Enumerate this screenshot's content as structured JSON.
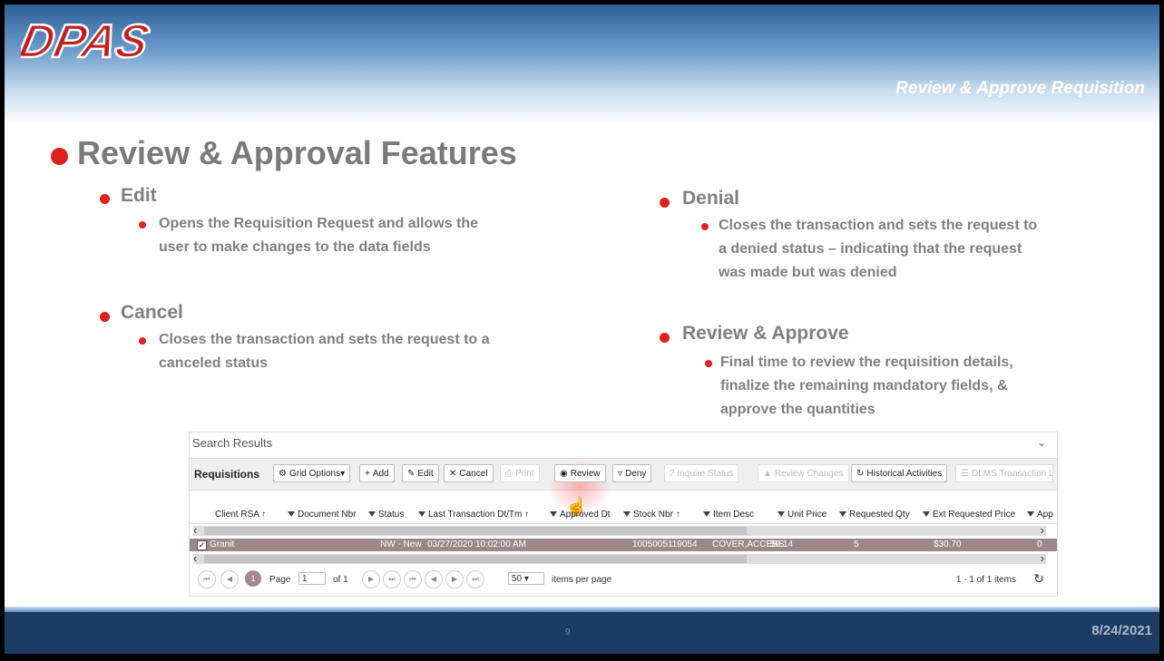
{
  "header": {
    "logo_text": "DPAS",
    "section_title": "Review & Approve Requisition"
  },
  "slide": {
    "main_heading": "Review & Approval Features",
    "left": [
      {
        "label": "Edit",
        "detail": [
          "Opens the Requisition Request and allows the",
          "user to make changes to the data fields"
        ]
      },
      {
        "label": "Cancel",
        "detail": [
          "Closes the transaction and sets the request to a",
          "canceled status"
        ]
      }
    ],
    "right": [
      {
        "label": "Denial",
        "detail": [
          "Closes the transaction and sets the request to",
          "a denied status – indicating that the request",
          "was made but was denied"
        ]
      },
      {
        "label": "Review & Approve",
        "detail": [
          "Final time to review the requisition details,",
          "finalize the remaining mandatory fields, &",
          "approve the quantities"
        ]
      }
    ]
  },
  "grid": {
    "search_results_label": "Search Results",
    "grid_title": "Requisitions",
    "toolbar": {
      "grid_options": "Grid Options▾",
      "add": "Add",
      "edit": "Edit",
      "cancel": "Cancel",
      "print": "Print",
      "review": "Review",
      "deny": "Deny",
      "inquire_status": "Inquire Status",
      "review_changes": "Review Changes",
      "historical_activities": "Historical Activities",
      "dlms_transaction": "DLMS Transaction L"
    },
    "columns": [
      "Client RSA",
      "Document Nbr",
      "Status",
      "Last Transaction Dt/Tm",
      "Approved Dt",
      "Stock Nbr",
      "Item Desc",
      "Unit Price",
      "Requested Qty",
      "Ext Requested Price",
      "App"
    ],
    "sort_indicator": "↑",
    "rows": [
      {
        "checked": "✓",
        "client_rsa": "Granit",
        "document_nbr": "",
        "status": "NW - New",
        "last_transaction": "03/27/2020 10:02:00 AM",
        "approved_dt": "",
        "stock_nbr": "1005005119054",
        "item_desc": "COVER,ACCESS",
        "unit_price": "$6.14",
        "requested_qty": "5",
        "ext_requested_price": "$30.70",
        "app": "0"
      }
    ],
    "pager": {
      "current_page": "1",
      "page_label": "Page",
      "page_value": "1",
      "of_label": "of 1",
      "page_size": "50",
      "items_per_page": "items per page",
      "summary": "1 - 1 of 1 items"
    }
  },
  "footer": {
    "page_number": "9",
    "date": "8/24/2021"
  },
  "colors": {
    "accent_red": "#e0201b",
    "header_blue": "#2d5f98",
    "footer_navy": "#1c3b63",
    "selected_row": "#9d8888"
  }
}
